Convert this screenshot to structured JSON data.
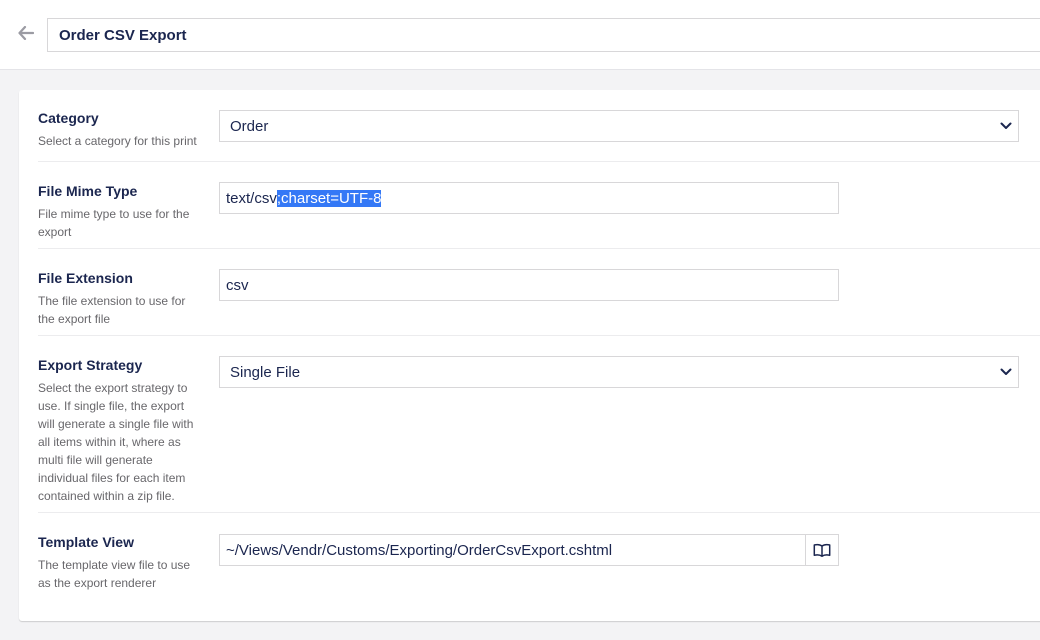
{
  "header": {
    "back_icon": "arrow-left-icon",
    "title": "Order CSV Export"
  },
  "fields": {
    "category": {
      "label": "Category",
      "description": "Select a category for this print",
      "value": "Order"
    },
    "mime_type": {
      "label": "File Mime Type",
      "description": "File mime type to use for the export",
      "value_plain": "text/csv",
      "value_selected": ";charset=UTF-8"
    },
    "extension": {
      "label": "File Extension",
      "description": "The file extension to use for the export file",
      "value": "csv"
    },
    "strategy": {
      "label": "Export Strategy",
      "description": "Select the export strategy to use. If single file, the export will generate a single file with all items within it, where as multi file will generate individual files for each item contained within a zip file.",
      "value": "Single File"
    },
    "template": {
      "label": "Template View",
      "description": "The template view file to use as the export renderer",
      "value": "~/Views/Vendr/Customs/Exporting/OrderCsvExport.cshtml",
      "button_icon": "open-book-icon"
    }
  },
  "colors": {
    "text": "#1b264f",
    "muted": "#68676b",
    "border": "#d8d7d9",
    "selection": "#3478f6",
    "background": "#f3f3f5"
  }
}
